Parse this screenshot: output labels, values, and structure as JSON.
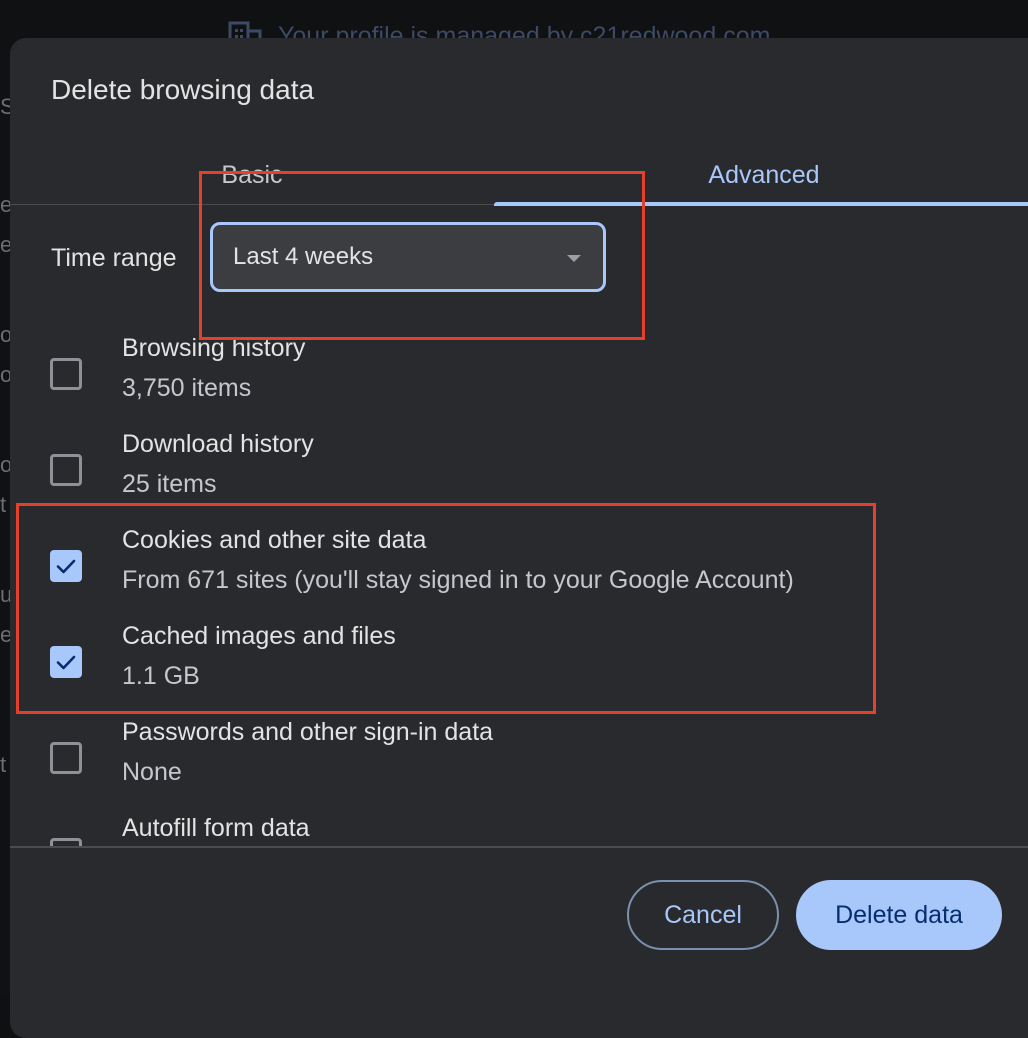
{
  "background": {
    "managed_text": "Your profile is managed by c21redwood.com"
  },
  "dialog": {
    "title": "Delete browsing data",
    "tabs": [
      {
        "label": "Basic",
        "selected": false
      },
      {
        "label": "Advanced",
        "selected": true
      }
    ],
    "time_range": {
      "label": "Time range",
      "value": "Last 4 weeks"
    },
    "items": [
      {
        "title": "Browsing history",
        "subtitle": "3,750 items",
        "checked": false
      },
      {
        "title": "Download history",
        "subtitle": "25 items",
        "checked": false
      },
      {
        "title": "Cookies and other site data",
        "subtitle": "From 671 sites (you'll stay signed in to your Google Account)",
        "checked": true
      },
      {
        "title": "Cached images and files",
        "subtitle": "1.1 GB",
        "checked": true
      },
      {
        "title": "Passwords and other sign-in data",
        "subtitle": "None",
        "checked": false
      },
      {
        "title": "Autofill form data",
        "subtitle": "",
        "checked": false
      }
    ],
    "buttons": {
      "cancel": "Cancel",
      "delete": "Delete data"
    }
  },
  "colors": {
    "accent": "#a8c7fa",
    "dialog_bg": "#292a2d",
    "annotation": "#e4402c"
  }
}
